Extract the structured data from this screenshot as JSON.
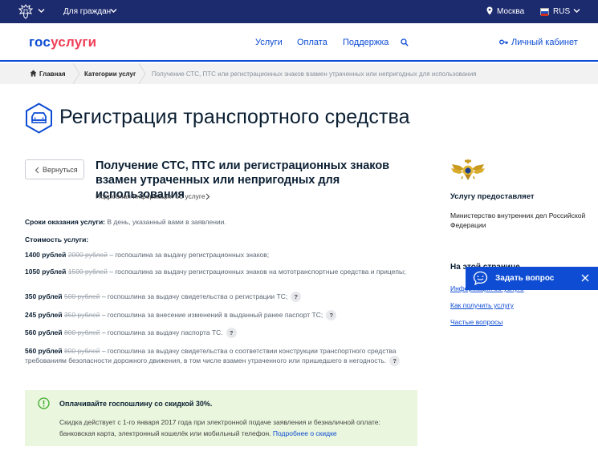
{
  "topbar": {
    "for_citizens": "Для граждан",
    "city": "Москва",
    "lang": "RUS"
  },
  "header": {
    "logo_gos": "гос",
    "logo_uslugi": "услуги",
    "nav": [
      "Услуги",
      "Оплата",
      "Поддержка"
    ],
    "cabinet": "Личный кабинет"
  },
  "breadcrumbs": [
    "Главная",
    "Категории услуг",
    "Получение СТС, ПТС или регистрационных знаков взамен утраченных или непригодных для использования"
  ],
  "page_title": "Регистрация транспортного средства",
  "back_label": "Вернуться",
  "service": {
    "title": "Получение СТС, ПТС или регистрационных знаков взамен утраченных или непригодных для использования",
    "more_info": "Подробная информация об услуге"
  },
  "terms": {
    "label": "Сроки оказания услуги:",
    "value": " В день, указанный вами в заявлении."
  },
  "cost_label": "Стоимость услуги:",
  "prices": [
    {
      "price": "1400 рублей",
      "old": "2000 рублей",
      "desc": " – госпошлина за выдачу регистрационных знаков;",
      "help": false
    },
    {
      "price": "1050 рублей",
      "old": "1500 рублей",
      "desc": " – госпошлина за выдачу регистрационных знаков на мототранспортные средства и прицепы;",
      "help": false
    },
    {
      "price": "350 рублей",
      "old": "500 рублей",
      "desc": " – госпошлина за выдачу свидетельства о регистрации ТС;",
      "help": true
    },
    {
      "price": "245 рублей",
      "old": "350 рублей",
      "desc": " – госпошлина за внесение изменений в выданный ранее паспорт ТС;",
      "help": true
    },
    {
      "price": "560 рублей",
      "old": "800 рублей",
      "desc": " – госпошлина за выдачу паспорта ТС.",
      "help": true
    },
    {
      "price": "560 рублей",
      "old": "800 рублей",
      "desc": " – госпошлина за выдачу свидетельства о соответствии конструкции транспортного средства требованиям безопасности дорожного движения, в том числе взамен утраченного или пришедшего в негодность.",
      "help": true
    }
  ],
  "help_glyph": "?",
  "discount": {
    "title": "Оплачивайте госпошлину со скидкой 30%.",
    "text": "Скидка действует с 1-го января 2017 года при электронной подаче заявления и безналичной оплате: банковская карта, электронный кошелёк или мобильный телефон. ",
    "link": "Подробнее о скидке"
  },
  "sidebar": {
    "provider_label": "Услугу предоставляет",
    "provider_name": "Министерство внутренних дел Российской Федерации",
    "section_heading": "На этой странице",
    "links": [
      "Информация об услуге",
      "Как получить услугу",
      "Частые вопросы"
    ]
  },
  "ask": {
    "label": "Задать вопрос"
  },
  "colors": {
    "topbar": "#1c2a6e",
    "brand_blue": "#0d4cd3",
    "brand_red": "#ee3f58",
    "discount_bg": "#eaf6dd"
  }
}
